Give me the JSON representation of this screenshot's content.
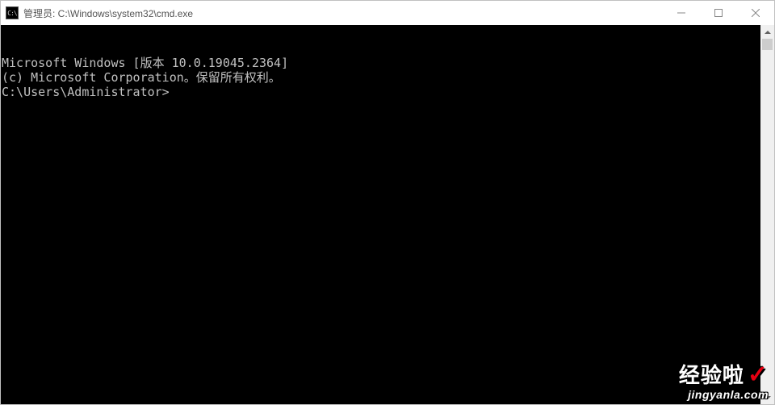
{
  "titlebar": {
    "icon_label": "C:\\",
    "text": "管理员: C:\\Windows\\system32\\cmd.exe"
  },
  "controls": {
    "minimize": "minimize",
    "maximize": "maximize",
    "close": "close"
  },
  "console": {
    "line1": "Microsoft Windows [版本 10.0.19045.2364]",
    "line2": "(c) Microsoft Corporation。保留所有权利。",
    "blank": "",
    "prompt": "C:\\Users\\Administrator>"
  },
  "watermark": {
    "brand": "经验啦",
    "check": "✓",
    "url": "jingyanla.com"
  }
}
